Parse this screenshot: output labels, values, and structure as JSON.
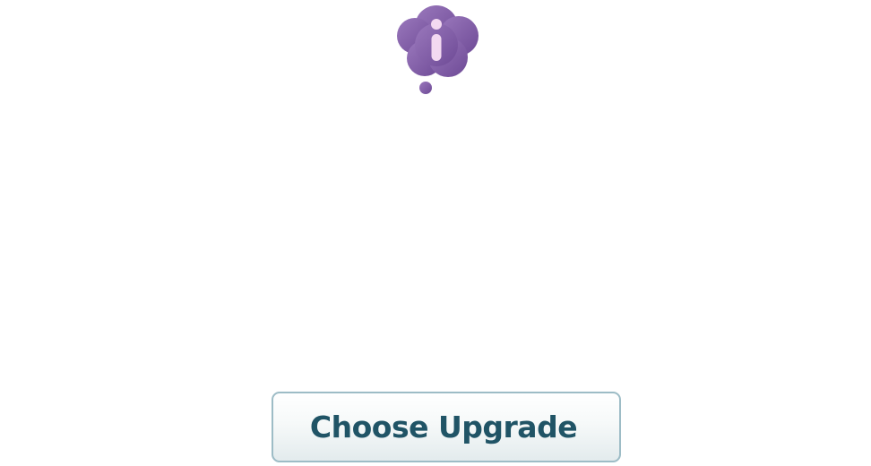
{
  "dialog": {
    "icon": "info-thought-cloud-icon",
    "accent_color": "#7f5aa6",
    "glyph_color": "#f3d9f1",
    "primary_button": {
      "label": "Choose Upgrade",
      "text_color": "#205466",
      "border_color": "#9dbcc6"
    }
  }
}
